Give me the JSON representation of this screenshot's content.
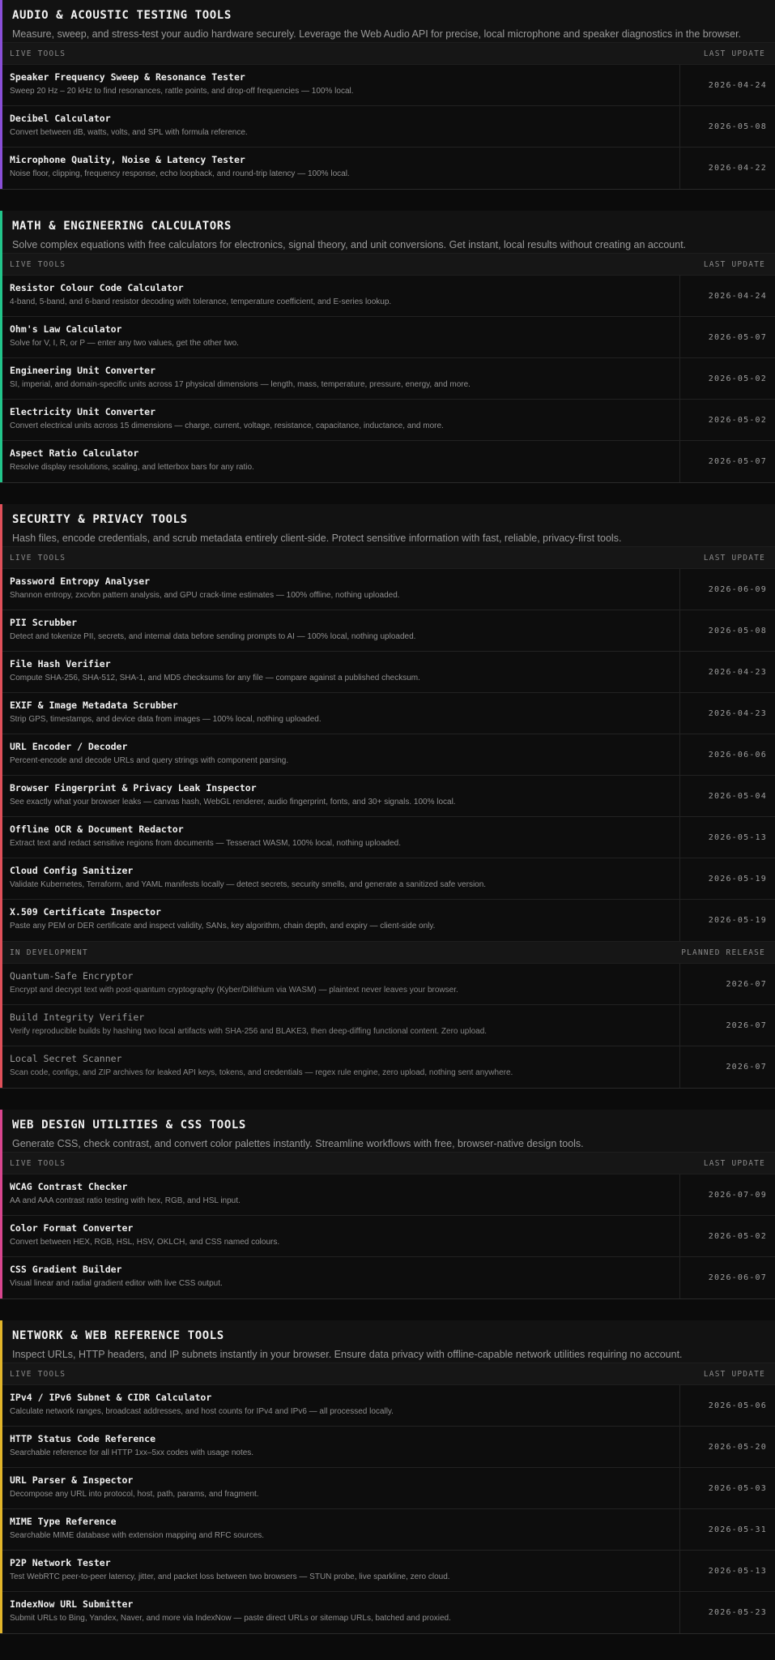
{
  "sections": [
    {
      "title": "AUDIO & ACOUSTIC TESTING TOOLS",
      "subtitle": "Measure, sweep, and stress-test your audio hardware securely. Leverage the Web Audio API for precise, local microphone and speaker diagnostics in the browser.",
      "accent": "#8a4fd8",
      "groups": [
        {
          "label": "LIVE TOOLS",
          "date_label": "LAST UPDATE",
          "status": "live",
          "tools": [
            {
              "name": "Speaker Frequency Sweep & Resonance Tester",
              "desc": "Sweep 20 Hz – 20 kHz to find resonances, rattle points, and drop-off frequencies — 100% local.",
              "date": "2026-04-24"
            },
            {
              "name": "Decibel Calculator",
              "desc": "Convert between dB, watts, volts, and SPL with formula reference.",
              "date": "2026-05-08"
            },
            {
              "name": "Microphone Quality, Noise & Latency Tester",
              "desc": "Noise floor, clipping, frequency response, echo loopback, and round-trip latency — 100% local.",
              "date": "2026-04-22"
            }
          ]
        }
      ]
    },
    {
      "title": "MATH & ENGINEERING CALCULATORS",
      "subtitle": "Solve complex equations with free calculators for electronics, signal theory, and unit conversions. Get instant, local results without creating an account.",
      "accent": "#22c58b",
      "groups": [
        {
          "label": "LIVE TOOLS",
          "date_label": "LAST UPDATE",
          "status": "live",
          "tools": [
            {
              "name": "Resistor Colour Code Calculator",
              "desc": "4-band, 5-band, and 6-band resistor decoding with tolerance, temperature coefficient, and E-series lookup.",
              "date": "2026-04-24"
            },
            {
              "name": "Ohm's Law Calculator",
              "desc": "Solve for V, I, R, or P — enter any two values, get the other two.",
              "date": "2026-05-07"
            },
            {
              "name": "Engineering Unit Converter",
              "desc": "SI, imperial, and domain-specific units across 17 physical dimensions — length, mass, temperature, pressure, energy, and more.",
              "date": "2026-05-02"
            },
            {
              "name": "Electricity Unit Converter",
              "desc": "Convert electrical units across 15 dimensions — charge, current, voltage, resistance, capacitance, inductance, and more.",
              "date": "2026-05-02"
            },
            {
              "name": "Aspect Ratio Calculator",
              "desc": "Resolve display resolutions, scaling, and letterbox bars for any ratio.",
              "date": "2026-05-07"
            }
          ]
        }
      ]
    },
    {
      "title": "SECURITY & PRIVACY TOOLS",
      "subtitle": "Hash files, encode credentials, and scrub metadata entirely client-side. Protect sensitive information with fast, reliable, privacy-first tools.",
      "accent": "#e0505a",
      "groups": [
        {
          "label": "LIVE TOOLS",
          "date_label": "LAST UPDATE",
          "status": "live",
          "tools": [
            {
              "name": "Password Entropy Analyser",
              "desc": "Shannon entropy, zxcvbn pattern analysis, and GPU crack-time estimates — 100% offline, nothing uploaded.",
              "date": "2026-06-09"
            },
            {
              "name": "PII Scrubber",
              "desc": "Detect and tokenize PII, secrets, and internal data before sending prompts to AI — 100% local, nothing uploaded.",
              "date": "2026-05-08"
            },
            {
              "name": "File Hash Verifier",
              "desc": "Compute SHA-256, SHA-512, SHA-1, and MD5 checksums for any file — compare against a published checksum.",
              "date": "2026-04-23"
            },
            {
              "name": "EXIF & Image Metadata Scrubber",
              "desc": "Strip GPS, timestamps, and device data from images — 100% local, nothing uploaded.",
              "date": "2026-04-23"
            },
            {
              "name": "URL Encoder / Decoder",
              "desc": "Percent-encode and decode URLs and query strings with component parsing.",
              "date": "2026-06-06"
            },
            {
              "name": "Browser Fingerprint & Privacy Leak Inspector",
              "desc": "See exactly what your browser leaks — canvas hash, WebGL renderer, audio fingerprint, fonts, and 30+ signals. 100% local.",
              "date": "2026-05-04"
            },
            {
              "name": "Offline OCR & Document Redactor",
              "desc": "Extract text and redact sensitive regions from documents — Tesseract WASM, 100% local, nothing uploaded.",
              "date": "2026-05-13"
            },
            {
              "name": "Cloud Config Sanitizer",
              "desc": "Validate Kubernetes, Terraform, and YAML manifests locally — detect secrets, security smells, and generate a sanitized safe version.",
              "date": "2026-05-19"
            },
            {
              "name": "X.509 Certificate Inspector",
              "desc": "Paste any PEM or DER certificate and inspect validity, SANs, key algorithm, chain depth, and expiry — client-side only.",
              "date": "2026-05-19"
            }
          ]
        },
        {
          "label": "IN DEVELOPMENT",
          "date_label": "PLANNED RELEASE",
          "status": "dev",
          "tools": [
            {
              "name": "Quantum-Safe Encryptor",
              "desc": "Encrypt and decrypt text with post-quantum cryptography (Kyber/Dilithium via WASM) — plaintext never leaves your browser.",
              "date": "2026-07"
            },
            {
              "name": "Build Integrity Verifier",
              "desc": "Verify reproducible builds by hashing two local artifacts with SHA-256 and BLAKE3, then deep-diffing functional content. Zero upload.",
              "date": "2026-07"
            },
            {
              "name": "Local Secret Scanner",
              "desc": "Scan code, configs, and ZIP archives for leaked API keys, tokens, and credentials — regex rule engine, zero upload, nothing sent anywhere.",
              "date": "2026-07"
            }
          ]
        }
      ]
    },
    {
      "title": "WEB DESIGN UTILITIES & CSS TOOLS",
      "subtitle": "Generate CSS, check contrast, and convert color palettes instantly. Streamline workflows with free, browser-native design tools.",
      "accent": "#d9468f",
      "groups": [
        {
          "label": "LIVE TOOLS",
          "date_label": "LAST UPDATE",
          "status": "live",
          "tools": [
            {
              "name": "WCAG Contrast Checker",
              "desc": "AA and AAA contrast ratio testing with hex, RGB, and HSL input.",
              "date": "2026-07-09"
            },
            {
              "name": "Color Format Converter",
              "desc": "Convert between HEX, RGB, HSL, HSV, OKLCH, and CSS named colours.",
              "date": "2026-05-02"
            },
            {
              "name": "CSS Gradient Builder",
              "desc": "Visual linear and radial gradient editor with live CSS output.",
              "date": "2026-06-07"
            }
          ]
        }
      ]
    },
    {
      "title": "NETWORK & WEB REFERENCE TOOLS",
      "subtitle": "Inspect URLs, HTTP headers, and IP subnets instantly in your browser. Ensure data privacy with offline-capable network utilities requiring no account.",
      "accent": "#e2b52a",
      "groups": [
        {
          "label": "LIVE TOOLS",
          "date_label": "LAST UPDATE",
          "status": "live",
          "tools": [
            {
              "name": "IPv4 / IPv6 Subnet & CIDR Calculator",
              "desc": "Calculate network ranges, broadcast addresses, and host counts for IPv4 and IPv6 — all processed locally.",
              "date": "2026-05-06"
            },
            {
              "name": "HTTP Status Code Reference",
              "desc": "Searchable reference for all HTTP 1xx–5xx codes with usage notes.",
              "date": "2026-05-20"
            },
            {
              "name": "URL Parser & Inspector",
              "desc": "Decompose any URL into protocol, host, path, params, and fragment.",
              "date": "2026-05-03"
            },
            {
              "name": "MIME Type Reference",
              "desc": "Searchable MIME database with extension mapping and RFC sources.",
              "date": "2026-05-31"
            },
            {
              "name": "P2P Network Tester",
              "desc": "Test WebRTC peer-to-peer latency, jitter, and packet loss between two browsers — STUN probe, live sparkline, zero cloud.",
              "date": "2026-05-13"
            },
            {
              "name": "IndexNow URL Submitter",
              "desc": "Submit URLs to Bing, Yandex, Naver, and more via IndexNow — paste direct URLs or sitemap URLs, batched and proxied.",
              "date": "2026-05-23"
            }
          ]
        }
      ]
    }
  ]
}
